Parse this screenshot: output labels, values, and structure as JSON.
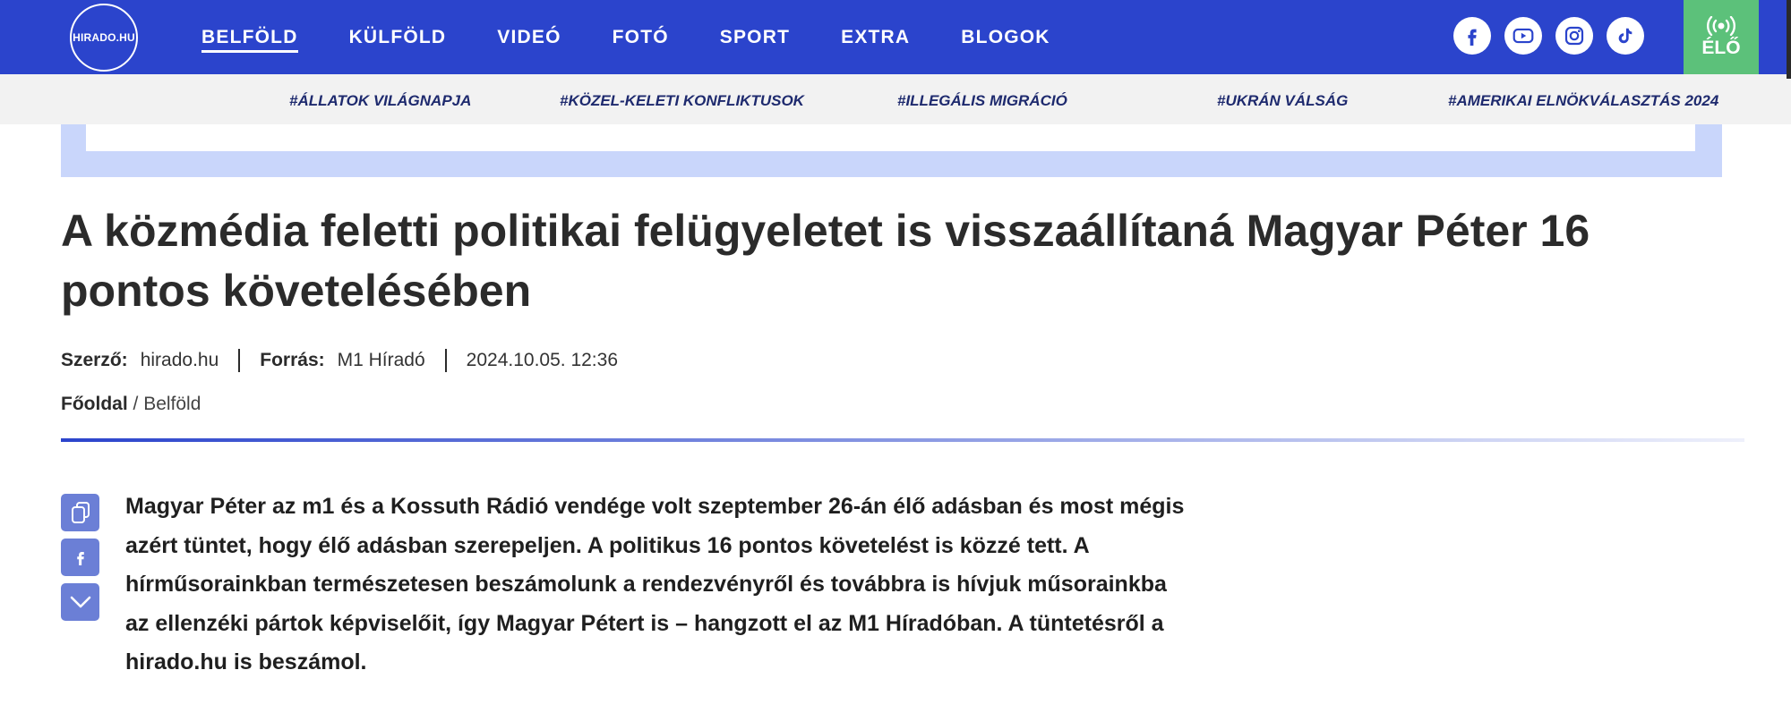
{
  "header": {
    "logo_text": "HIRADO.HU",
    "nav": [
      {
        "label": "BELFÖLD",
        "active": true
      },
      {
        "label": "KÜLFÖLD"
      },
      {
        "label": "VIDEÓ"
      },
      {
        "label": "FOTÓ"
      },
      {
        "label": "SPORT"
      },
      {
        "label": "EXTRA"
      },
      {
        "label": "BLOGOK"
      }
    ],
    "socials": [
      "facebook-icon",
      "youtube-icon",
      "instagram-icon",
      "tiktok-icon"
    ],
    "live_label": "ÉLŐ",
    "colors": {
      "bar": "#2b44cc",
      "live": "#5cc17a"
    }
  },
  "tags": [
    "#ÁLLATOK VILÁGNAPJA",
    "#KÖZEL-KELETI KONFLIKTUSOK",
    "#ILLEGÁLIS MIGRÁCIÓ",
    "#UKRÁN VÁLSÁG",
    "#AMERIKAI ELNÖKVÁLASZTÁS 2024"
  ],
  "article": {
    "title": "A közmédia feletti politikai felügyeletet is visszaállítaná Magyar Péter 16 pontos követelésében",
    "meta": {
      "author_label": "Szerző:",
      "author": "hirado.hu",
      "source_label": "Forrás:",
      "source": "M1 Híradó",
      "datetime": "2024.10.05. 12:36"
    },
    "breadcrumb": {
      "home": "Főoldal",
      "separator": " / ",
      "section": "Belföld"
    },
    "share_buttons": [
      "copy-icon",
      "facebook-icon",
      "chevron-down-icon"
    ],
    "lead": "Magyar Péter az m1 és a Kossuth Rádió vendége volt szeptember 26-án élő adásban és most mégis azért tüntet, hogy élő adásban szerepeljen. A politikus 16 pontos követelést is közzé tett. A hírműsorainkban természetesen beszámolunk a rendezvényről és továbbra is hívjuk műsorainkba az ellenzéki pártok képviselőit, így Magyar Pétert is – hangzott el az M1 Híradóban. A tüntetésről a hirado.hu is beszámol."
  }
}
